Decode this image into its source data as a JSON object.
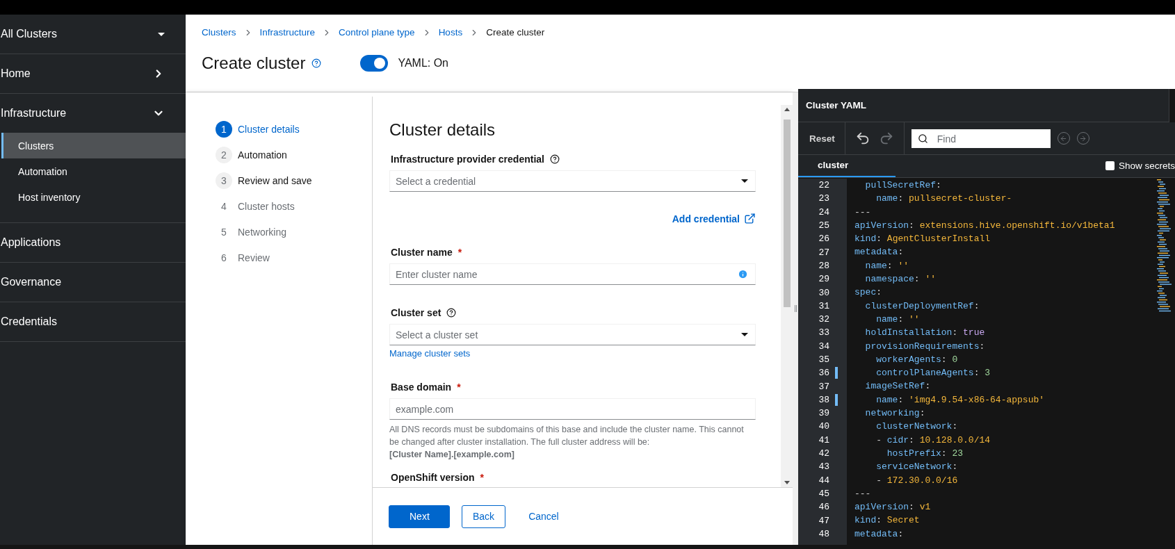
{
  "sidebar": {
    "items": [
      {
        "kind": "switcher",
        "label": "All Clusters"
      },
      {
        "kind": "group",
        "label": "Home",
        "expanded": false
      },
      {
        "kind": "group",
        "label": "Infrastructure",
        "expanded": true,
        "children": [
          {
            "label": "Clusters",
            "selected": true
          },
          {
            "label": "Automation",
            "selected": false
          },
          {
            "label": "Host inventory",
            "selected": false
          }
        ]
      },
      {
        "kind": "link",
        "label": "Applications"
      },
      {
        "kind": "link",
        "label": "Governance"
      },
      {
        "kind": "link",
        "label": "Credentials"
      }
    ]
  },
  "breadcrumbs": [
    {
      "label": "Clusters",
      "current": false
    },
    {
      "label": "Infrastructure",
      "current": false
    },
    {
      "label": "Control plane type",
      "current": false
    },
    {
      "label": "Hosts",
      "current": false
    },
    {
      "label": "Create cluster",
      "current": true
    }
  ],
  "page_title": "Create cluster",
  "yaml_toggle": {
    "on": true,
    "label": "YAML: On"
  },
  "wizard": {
    "steps": [
      {
        "number": "1",
        "label": "Cluster details",
        "selected": true,
        "disabled": false
      },
      {
        "number": "2",
        "label": "Automation",
        "selected": false,
        "disabled": false
      },
      {
        "number": "3",
        "label": "Review and save",
        "selected": false,
        "disabled": false
      },
      {
        "number": "4",
        "label": "Cluster hosts",
        "selected": false,
        "disabled": true
      },
      {
        "number": "5",
        "label": "Networking",
        "selected": false,
        "disabled": true
      },
      {
        "number": "6",
        "label": "Review",
        "selected": false,
        "disabled": true
      }
    ],
    "section_title": "Cluster details",
    "fields": [
      {
        "kind": "select",
        "label": "Infrastructure provider credential",
        "help": true,
        "placeholder": "Select a credential",
        "action_link": "Add credential"
      },
      {
        "kind": "text",
        "label": "Cluster name",
        "required_mark": "*",
        "placeholder": "Enter cluster name",
        "info": true
      },
      {
        "kind": "select",
        "label": "Cluster set",
        "help": true,
        "placeholder": "Select a cluster set",
        "below_link": "Manage cluster sets"
      },
      {
        "kind": "text",
        "label": "Base domain",
        "required_mark": "*",
        "placeholder": "example.com",
        "helper": "All DNS records must be subdomains of this base and include the cluster name. This cannot be changed after cluster installation. The full cluster address will be:",
        "helper_bold": "[Cluster Name].[example.com]"
      },
      {
        "label": "OpenShift version",
        "required_mark": "*"
      }
    ],
    "buttons": [
      {
        "kind": "primary",
        "label": "Next"
      },
      {
        "kind": "secondary",
        "label": "Back"
      },
      {
        "kind": "link",
        "label": "Cancel"
      }
    ]
  },
  "yaml_panel": {
    "title": "Cluster YAML",
    "reset": "Reset",
    "find_placeholder": "Find",
    "tabs": [
      {
        "label": "cluster",
        "selected": true
      }
    ],
    "show_secrets": {
      "label": "Show secrets",
      "checked": false
    },
    "lines": [
      {
        "number": "22",
        "modified": false,
        "tokens": [
          {
            "kind": "key",
            "text": "  pullSecretRef"
          },
          {
            "kind": "punct",
            "text": ":"
          }
        ]
      },
      {
        "number": "23",
        "modified": false,
        "tokens": [
          {
            "kind": "key",
            "text": "    name"
          },
          {
            "kind": "punct",
            "text": ": "
          },
          {
            "kind": "string",
            "text": "pullsecret-cluster-"
          }
        ]
      },
      {
        "number": "24",
        "modified": false,
        "tokens": [
          {
            "kind": "punct",
            "text": "---"
          }
        ]
      },
      {
        "number": "25",
        "modified": false,
        "tokens": [
          {
            "kind": "key",
            "text": "apiVersion"
          },
          {
            "kind": "punct",
            "text": ": "
          },
          {
            "kind": "string",
            "text": "extensions.hive.openshift.io/v1beta1"
          }
        ]
      },
      {
        "number": "26",
        "modified": false,
        "tokens": [
          {
            "kind": "key",
            "text": "kind"
          },
          {
            "kind": "punct",
            "text": ": "
          },
          {
            "kind": "string",
            "text": "AgentClusterInstall"
          }
        ]
      },
      {
        "number": "27",
        "modified": false,
        "tokens": [
          {
            "kind": "key",
            "text": "metadata"
          },
          {
            "kind": "punct",
            "text": ":"
          }
        ]
      },
      {
        "number": "28",
        "modified": false,
        "tokens": [
          {
            "kind": "key",
            "text": "  name"
          },
          {
            "kind": "punct",
            "text": ": "
          },
          {
            "kind": "string",
            "text": "''"
          }
        ]
      },
      {
        "number": "29",
        "modified": false,
        "tokens": [
          {
            "kind": "key",
            "text": "  namespace"
          },
          {
            "kind": "punct",
            "text": ": "
          },
          {
            "kind": "string",
            "text": "''"
          }
        ]
      },
      {
        "number": "30",
        "modified": false,
        "tokens": [
          {
            "kind": "key",
            "text": "spec"
          },
          {
            "kind": "punct",
            "text": ":"
          }
        ]
      },
      {
        "number": "31",
        "modified": false,
        "tokens": [
          {
            "kind": "key",
            "text": "  clusterDeploymentRef"
          },
          {
            "kind": "punct",
            "text": ":"
          }
        ]
      },
      {
        "number": "32",
        "modified": false,
        "tokens": [
          {
            "kind": "key",
            "text": "    name"
          },
          {
            "kind": "punct",
            "text": ": "
          },
          {
            "kind": "string",
            "text": "''"
          }
        ]
      },
      {
        "number": "33",
        "modified": false,
        "tokens": [
          {
            "kind": "key",
            "text": "  holdInstallation"
          },
          {
            "kind": "punct",
            "text": ": "
          },
          {
            "kind": "bool",
            "text": "true"
          }
        ]
      },
      {
        "number": "34",
        "modified": false,
        "tokens": [
          {
            "kind": "key",
            "text": "  provisionRequirements"
          },
          {
            "kind": "punct",
            "text": ":"
          }
        ]
      },
      {
        "number": "35",
        "modified": false,
        "tokens": [
          {
            "kind": "key",
            "text": "    workerAgents"
          },
          {
            "kind": "punct",
            "text": ": "
          },
          {
            "kind": "number",
            "text": "0"
          }
        ]
      },
      {
        "number": "36",
        "modified": true,
        "tokens": [
          {
            "kind": "key",
            "text": "    controlPlaneAgents"
          },
          {
            "kind": "punct",
            "text": ": "
          },
          {
            "kind": "number",
            "text": "3"
          }
        ]
      },
      {
        "number": "37",
        "modified": false,
        "tokens": [
          {
            "kind": "key",
            "text": "  imageSetRef"
          },
          {
            "kind": "punct",
            "text": ":"
          }
        ]
      },
      {
        "number": "38",
        "modified": true,
        "tokens": [
          {
            "kind": "key",
            "text": "    name"
          },
          {
            "kind": "punct",
            "text": ": "
          },
          {
            "kind": "string",
            "text": "'img4.9.54-x86-64-appsub'"
          }
        ]
      },
      {
        "number": "39",
        "modified": false,
        "tokens": [
          {
            "kind": "key",
            "text": "  networking"
          },
          {
            "kind": "punct",
            "text": ":"
          }
        ]
      },
      {
        "number": "40",
        "modified": false,
        "tokens": [
          {
            "kind": "key",
            "text": "    clusterNetwork"
          },
          {
            "kind": "punct",
            "text": ":"
          }
        ]
      },
      {
        "number": "41",
        "modified": false,
        "tokens": [
          {
            "kind": "punct",
            "text": "    - "
          },
          {
            "kind": "key",
            "text": "cidr"
          },
          {
            "kind": "punct",
            "text": ": "
          },
          {
            "kind": "string",
            "text": "10.128.0.0/14"
          }
        ]
      },
      {
        "number": "42",
        "modified": false,
        "tokens": [
          {
            "kind": "key",
            "text": "      hostPrefix"
          },
          {
            "kind": "punct",
            "text": ": "
          },
          {
            "kind": "number",
            "text": "23"
          }
        ]
      },
      {
        "number": "43",
        "modified": false,
        "tokens": [
          {
            "kind": "key",
            "text": "    serviceNetwork"
          },
          {
            "kind": "punct",
            "text": ":"
          }
        ]
      },
      {
        "number": "44",
        "modified": false,
        "tokens": [
          {
            "kind": "punct",
            "text": "    - "
          },
          {
            "kind": "string",
            "text": "172.30.0.0/16"
          }
        ]
      },
      {
        "number": "45",
        "modified": false,
        "tokens": [
          {
            "kind": "punct",
            "text": "---"
          }
        ]
      },
      {
        "number": "46",
        "modified": false,
        "tokens": [
          {
            "kind": "key",
            "text": "apiVersion"
          },
          {
            "kind": "punct",
            "text": ": "
          },
          {
            "kind": "string",
            "text": "v1"
          }
        ]
      },
      {
        "number": "47",
        "modified": false,
        "tokens": [
          {
            "kind": "key",
            "text": "kind"
          },
          {
            "kind": "punct",
            "text": ": "
          },
          {
            "kind": "string",
            "text": "Secret"
          }
        ]
      },
      {
        "number": "48",
        "modified": false,
        "tokens": [
          {
            "kind": "key",
            "text": "metadata"
          },
          {
            "kind": "punct",
            "text": ":"
          }
        ]
      }
    ]
  }
}
